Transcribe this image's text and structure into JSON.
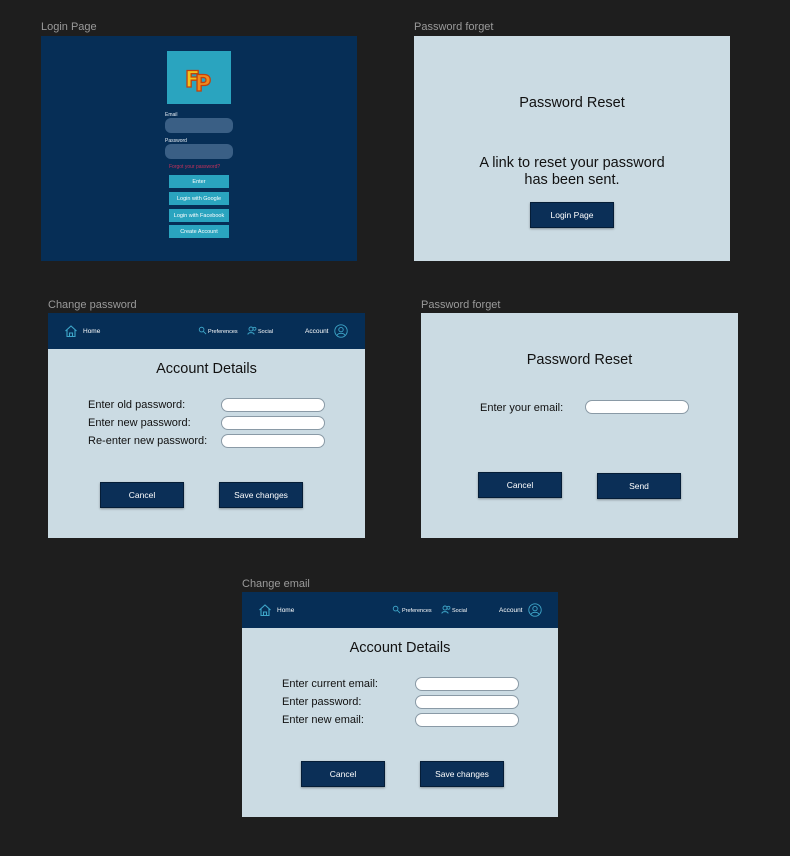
{
  "frames": {
    "login": {
      "title": "Login Page",
      "logo_text": "FP",
      "email_label": "Email",
      "password_label": "Password",
      "forgot_link": "Forgot your password?",
      "buttons": [
        "Enter",
        "Login with Google",
        "Login with Facebook",
        "Create Account"
      ]
    },
    "forget_sent": {
      "title": "Password forget",
      "heading": "Password Reset",
      "message_line1": "A link to reset your password",
      "message_line2": "has been sent.",
      "login_button": "Login Page"
    },
    "change_password": {
      "title": "Change password",
      "heading": "Account Details",
      "fields": [
        "Enter old password:",
        "Enter new password:",
        "Re-enter new password:"
      ],
      "cancel": "Cancel",
      "save": "Save changes"
    },
    "forget_email": {
      "title": "Password forget",
      "heading": "Password Reset",
      "email_label": "Enter your email:",
      "cancel": "Cancel",
      "send": "Send"
    },
    "change_email": {
      "title": "Change email",
      "heading": "Account Details",
      "fields": [
        "Enter current email:",
        "Enter password:",
        "Enter new email:"
      ],
      "cancel": "Cancel",
      "save": "Save changes"
    }
  },
  "nav": {
    "home": "Home",
    "preferences": "Preferences",
    "social": "Social",
    "account": "Account"
  },
  "colors": {
    "background": "#1e1e1e",
    "navy": "#062e56",
    "panel": "#cbdbe3",
    "teal": "#2aa4bf",
    "icon": "#3ea6c9"
  }
}
